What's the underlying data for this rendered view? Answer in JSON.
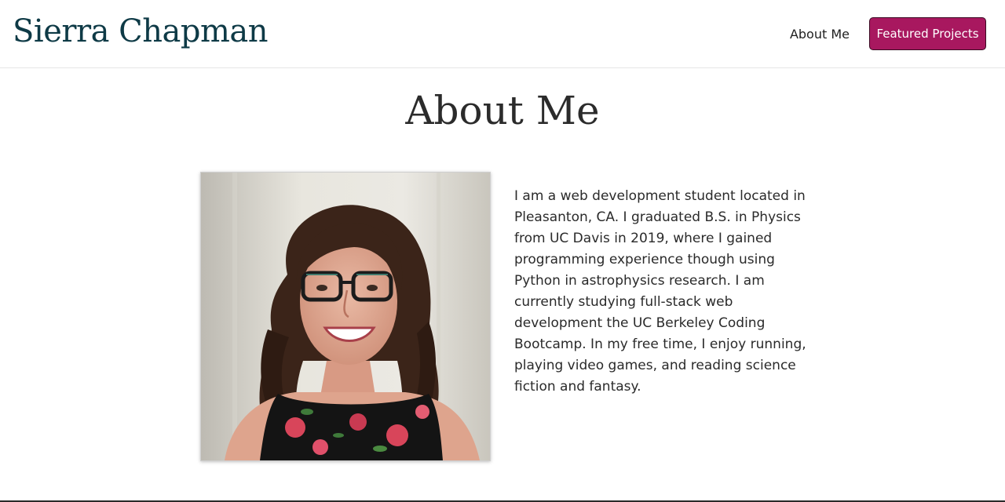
{
  "header": {
    "site_title": "Sierra Chapman",
    "nav": {
      "about_label": "About Me",
      "projects_label": "Featured Projects"
    }
  },
  "about": {
    "heading": "About Me",
    "bio": "I am a web development student located in Pleasanton, CA. I graduated B.S. in Physics from UC Davis in 2019, where I gained programming experience though using Python in astrophysics research. I am currently studying full-stack web development the UC Berkeley Coding Bootcamp. In my free time, I enjoy running, playing video games, and reading science fiction and fantasy."
  },
  "colors": {
    "title": "#0e3a46",
    "accent_button": "#a8185f",
    "text": "#2a2a2a"
  }
}
